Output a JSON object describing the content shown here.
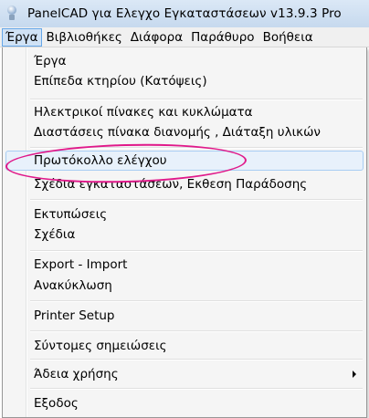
{
  "window": {
    "title": "PanelCAD για Ελεγχο Εγκαταστάσεων v13.9.3 Pro",
    "icon": "app-lamp-icon"
  },
  "menubar": {
    "items": [
      {
        "label": "Έργα",
        "active": true
      },
      {
        "label": "Βιβλιοθήκες",
        "active": false
      },
      {
        "label": "Διάφορα",
        "active": false
      },
      {
        "label": "Παράθυρο",
        "active": false
      },
      {
        "label": "Βοήθεια",
        "active": false
      }
    ]
  },
  "menu": {
    "items": [
      {
        "label": "Έργα"
      },
      {
        "label": "Επίπεδα κτηρίου (Κατόψεις)"
      },
      {
        "label": "Ηλεκτρικοί πίνακες και κυκλώματα"
      },
      {
        "label": "Διαστάσεις πίνακα διανομής , Διάταξη υλικών"
      },
      {
        "label": "Πρωτόκολλο ελέγχου",
        "highlighted": true
      },
      {
        "label": "Σχέδια εγκαταστάσεων, Εκθεση Παράδοσης"
      },
      {
        "label": "Εκτυπώσεις"
      },
      {
        "label": "Σχέδια"
      },
      {
        "label": "Export - Import"
      },
      {
        "label": "Ανακύκλωση"
      },
      {
        "label": "Printer Setup"
      },
      {
        "label": "Σύντομες σημειώσεις"
      },
      {
        "label": "Άδεια χρήσης",
        "has_submenu": true
      },
      {
        "label": "Εξοδος"
      }
    ]
  },
  "colors": {
    "annotation": "#e0198a",
    "active_menu_bg": "#d0e2f5",
    "hover_bg": "#e8f1fb"
  }
}
